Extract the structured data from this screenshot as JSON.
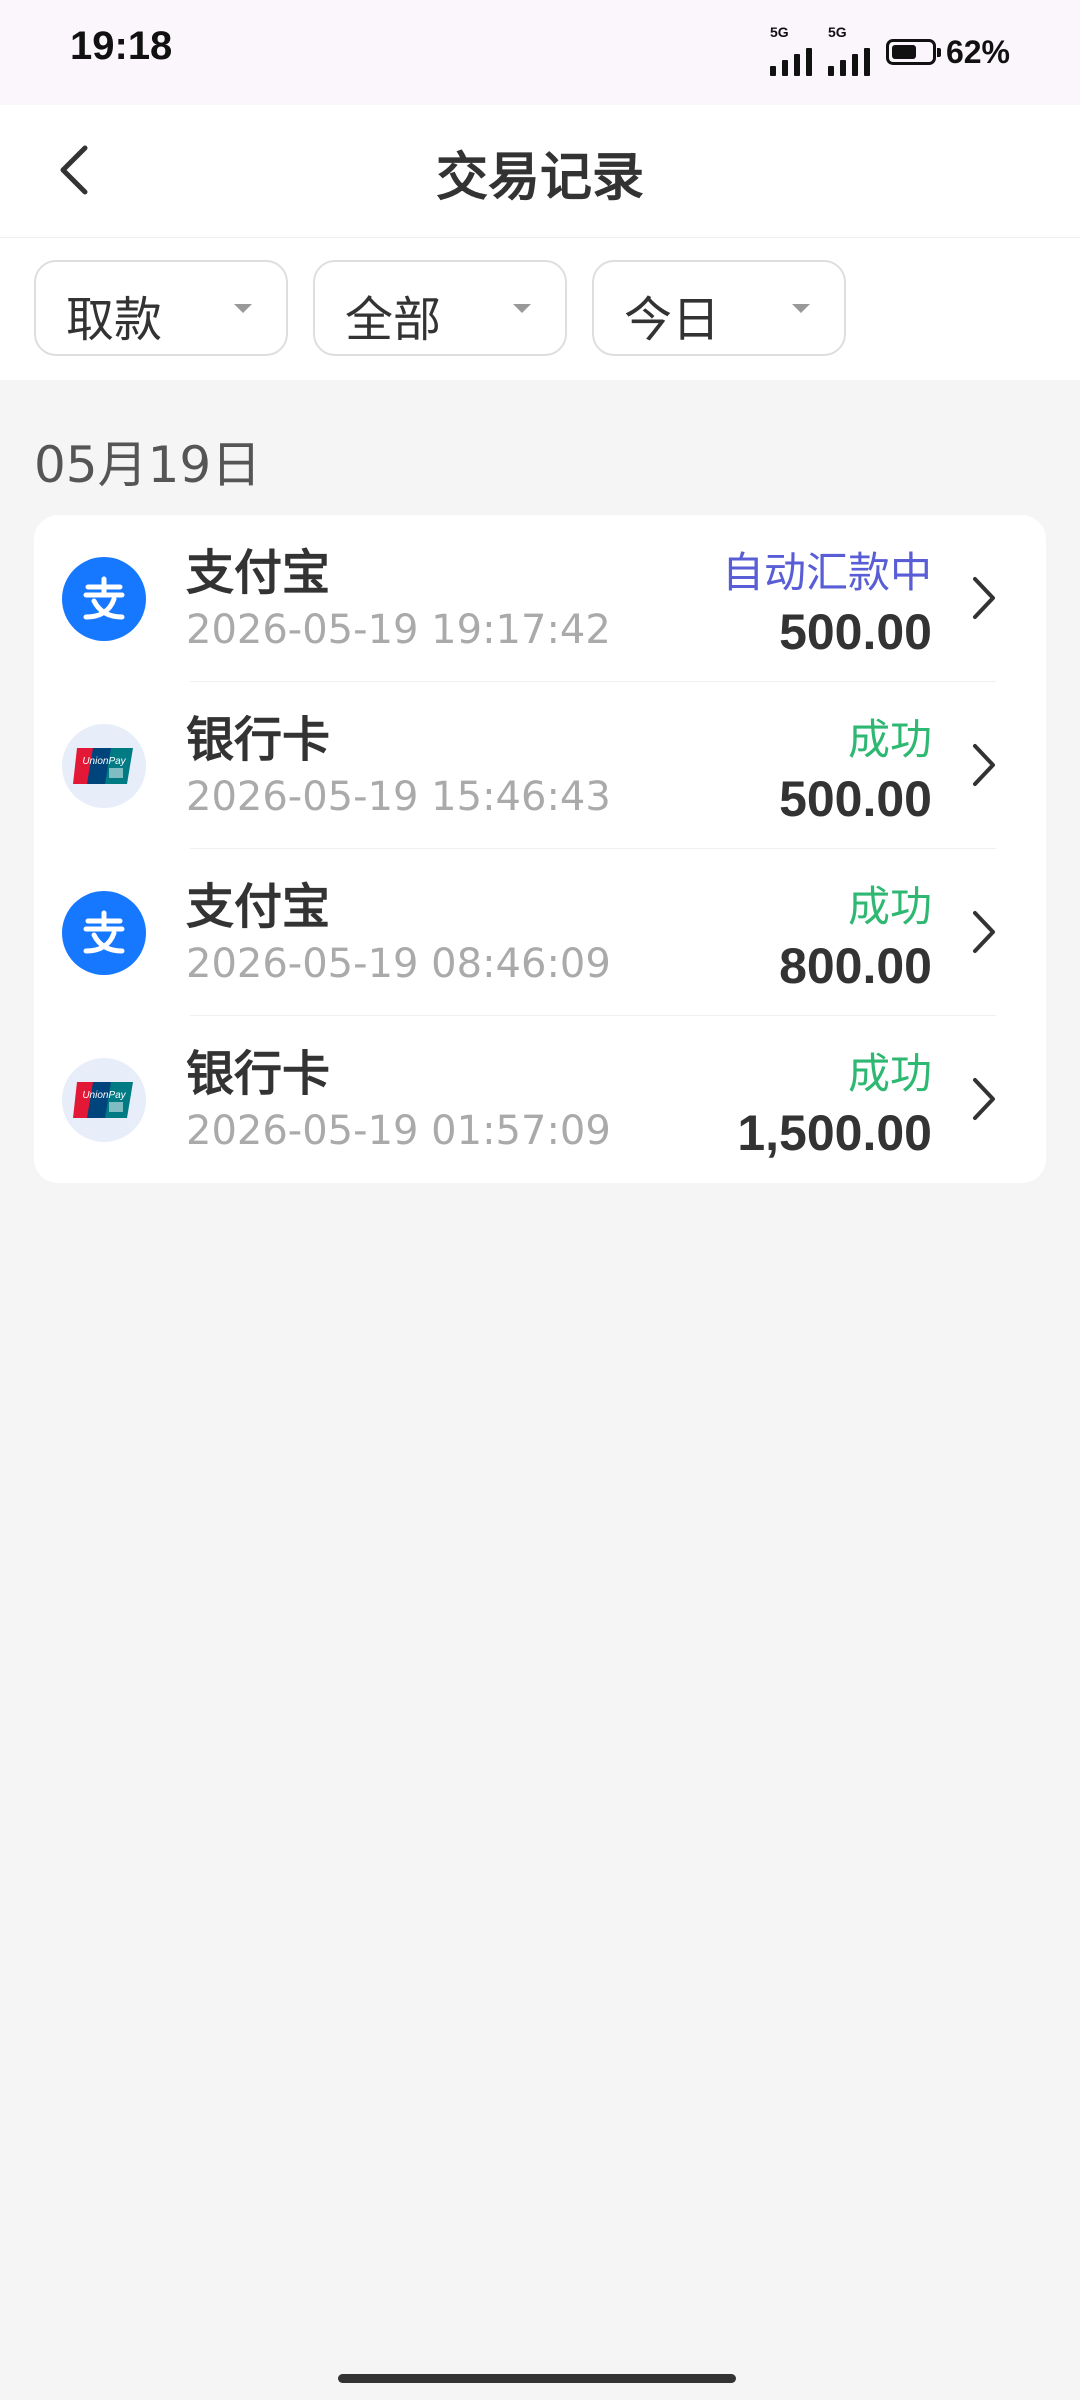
{
  "status_bar": {
    "time": "19:18",
    "signal_1_label": "5G",
    "signal_2_label": "5G",
    "battery_percent": "62%",
    "battery_level": 0.62
  },
  "header": {
    "title": "交易记录",
    "back_icon": "chevron-left-icon"
  },
  "filters": [
    {
      "label": "取款"
    },
    {
      "label": "全部"
    },
    {
      "label": "今日"
    }
  ],
  "group": {
    "date": "05月19日",
    "transactions": [
      {
        "method": "支付宝",
        "icon": "alipay-icon",
        "time": "2026-05-19 19:17:42",
        "status": "自动汇款中",
        "status_type": "pending",
        "amount": "500.00"
      },
      {
        "method": "银行卡",
        "icon": "unionpay-icon",
        "time": "2026-05-19 15:46:43",
        "status": "成功",
        "status_type": "success",
        "amount": "500.00"
      },
      {
        "method": "支付宝",
        "icon": "alipay-icon",
        "time": "2026-05-19 08:46:09",
        "status": "成功",
        "status_type": "success",
        "amount": "800.00"
      },
      {
        "method": "银行卡",
        "icon": "unionpay-icon",
        "time": "2026-05-19 01:57:09",
        "status": "成功",
        "status_type": "success",
        "amount": "1,500.00"
      }
    ]
  },
  "colors": {
    "pending": "#5a5ed6",
    "success": "#2eb872",
    "alipay_blue": "#1677ff",
    "background": "#f5f5f5"
  }
}
